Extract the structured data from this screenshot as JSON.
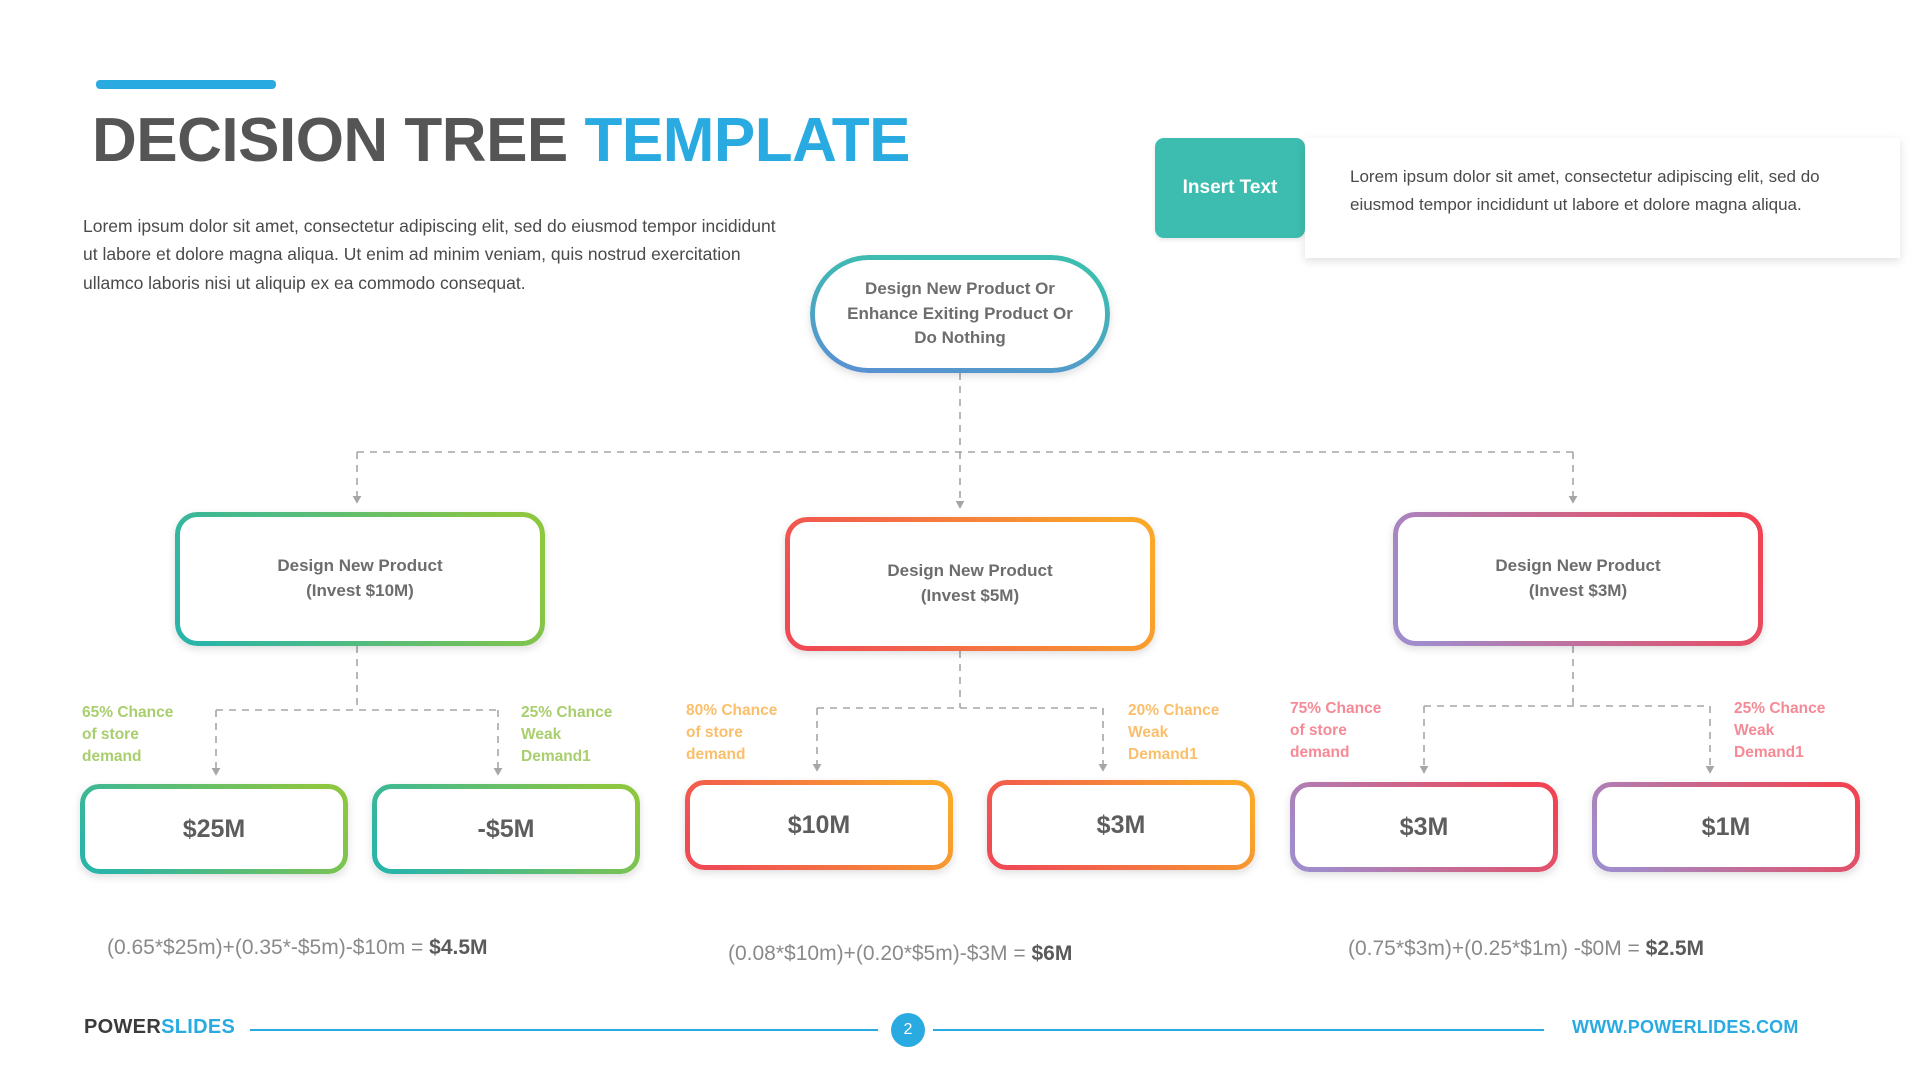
{
  "header": {
    "title_main": "DECISION TREE ",
    "title_highlight": "TEMPLATE",
    "subtitle": "Lorem ipsum dolor sit amet, consectetur adipiscing elit, sed do eiusmod tempor incididunt ut labore et dolore magna aliqua. Ut enim ad minim veniam, quis nostrud exercitation ullamco laboris nisi ut aliquip ex ea commodo consequat.",
    "insert_text_button": "Insert Text",
    "panel_text": "Lorem ipsum dolor sit amet, consectetur adipiscing elit, sed do eiusmod tempor incididunt ut labore et dolore magna aliqua.",
    "accent_color": "#29ABE2",
    "card_color": "#3CBDAF"
  },
  "chart_data": {
    "type": "diagram",
    "title": "Decision Tree Template",
    "root": {
      "label": "Design New Product Or\nEnhance Exiting Product Or\nDo Nothing",
      "line1": "Design New Product Or",
      "line2": "Enhance Exiting Product Or",
      "line3": "Do Nothing",
      "gradient_from": "#3CBDAF",
      "gradient_to": "#5B8FD4"
    },
    "branches": [
      {
        "decision_line1": "Design New Product",
        "decision_line2": "(Invest $10M)",
        "gradient_from": "#2BB5A8",
        "gradient_to": "#8DC63F",
        "label_color": "#A9CE6E",
        "left_chance": "65% Chance\nof store\ndemand",
        "left_chance_l1": "65% Chance",
        "left_chance_l2": "of store",
        "left_chance_l3": "demand",
        "right_chance_l1": "25% Chance",
        "right_chance_l2": "Weak",
        "right_chance_l3": "Demand1",
        "left_probability": 0.65,
        "right_probability": 0.25,
        "left_outcome": "$25M",
        "right_outcome": "-$5M",
        "leaf_left_gradient_from": "#2BB5A8",
        "leaf_left_gradient_to": "#8DC63F",
        "leaf_right_gradient_from": "#2BB5A8",
        "leaf_right_gradient_to": "#8DC63F",
        "formula_expr": "(0.65*$25m)+(0.35*-$5m)-$10m = ",
        "formula_result": "$4.5M"
      },
      {
        "decision_line1": "Design New Product",
        "decision_line2": "(Invest $5M)",
        "gradient_from": "#F04B55",
        "gradient_to": "#F9A829",
        "label_color": "#FBBF6B",
        "left_chance_l1": "80% Chance",
        "left_chance_l2": "of store",
        "left_chance_l3": "demand",
        "right_chance_l1": "20% Chance",
        "right_chance_l2": "Weak",
        "right_chance_l3": "Demand1",
        "left_probability": 0.8,
        "right_probability": 0.2,
        "left_outcome": "$10M",
        "right_outcome": "$3M",
        "leaf_left_gradient_from": "#F04B55",
        "leaf_left_gradient_to": "#F9A829",
        "leaf_right_gradient_from": "#F04B55",
        "leaf_right_gradient_to": "#F9A829",
        "formula_expr": "(0.08*$10m)+(0.20*$5m)-$3M = ",
        "formula_result": "$6M"
      },
      {
        "decision_line1": "Design New Product",
        "decision_line2": "(Invest $3M)",
        "gradient_from": "#A08CCB",
        "gradient_to": "#F04455",
        "label_color": "#F58A96",
        "left_chance_l1": "75% Chance",
        "left_chance_l2": "of store",
        "left_chance_l3": "demand",
        "right_chance_l1": "25% Chance",
        "right_chance_l2": "Weak",
        "right_chance_l3": "Demand1",
        "left_probability": 0.75,
        "right_probability": 0.25,
        "left_outcome": "$3M",
        "right_outcome": "$1M",
        "leaf_left_gradient_from": "#A08CCB",
        "leaf_left_gradient_to": "#F04455",
        "leaf_right_gradient_from": "#A08CCB",
        "leaf_right_gradient_to": "#F04455",
        "formula_expr": "(0.75*$3m)+(0.25*$1m) -$0M = ",
        "formula_result": "$2.5M"
      }
    ]
  },
  "footer": {
    "brand_part1": "POWER",
    "brand_part2": "SLIDES",
    "page_number": "2",
    "url": "WWW.POWERLIDES.COM"
  }
}
